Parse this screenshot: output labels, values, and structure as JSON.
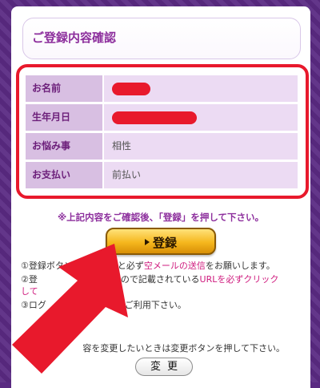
{
  "header": {
    "title": "ご登録内容確認"
  },
  "table": {
    "rows": [
      {
        "label": "お名前",
        "value": ""
      },
      {
        "label": "生年月日",
        "value": ""
      },
      {
        "label": "お悩み事",
        "value": "相性"
      },
      {
        "label": "お支払い",
        "value": "前払い"
      }
    ]
  },
  "notice": "※上記内容をご確認後、「登録」を押して下さい。",
  "register_button": {
    "label": "登録"
  },
  "instructions": {
    "line1_a": "①登録ボタンを押し",
    "line1_b": "ると必ず",
    "line1_link": "空メールの送信",
    "line1_c": "をお願いします。",
    "line2_a": "②登",
    "line2_b": "ますので記載されている",
    "line2_link": "URLを必ずクリック",
    "line3_a": "して",
    "line4_a": "③ログ",
    "line4_b": "スをご利用下さい。"
  },
  "change_note": "容を変更したいときは変更ボタンを押して下さい。",
  "change_button": {
    "label": "変更"
  },
  "colors": {
    "accent": "#8d2f9d",
    "highlight_red": "#e8192c",
    "link_pink": "#cf1b7e"
  }
}
